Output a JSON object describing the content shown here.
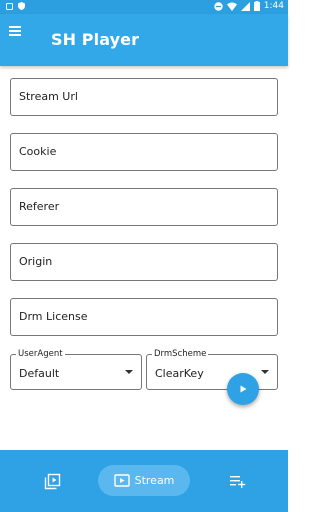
{
  "status_bar": {
    "time": "1:44"
  },
  "app_bar": {
    "title": "SH Player"
  },
  "form": {
    "stream_url": "Stream Url",
    "cookie": "Cookie",
    "referer": "Referer",
    "origin": "Origin",
    "drm_license": "Drm License"
  },
  "user_agent": {
    "caption": "UserAgent",
    "value": "Default"
  },
  "drm_scheme": {
    "caption": "DrmScheme",
    "value": "ClearKey"
  },
  "bottom_nav": {
    "stream_label": "Stream"
  },
  "colors": {
    "primary": "#33a8e8",
    "nav_background": "#2ea2e4",
    "active_pill": "#5ab8ef"
  },
  "icons": [
    "menu-icon",
    "play-icon",
    "video-library-icon",
    "stream-icon",
    "playlist-add-icon"
  ]
}
